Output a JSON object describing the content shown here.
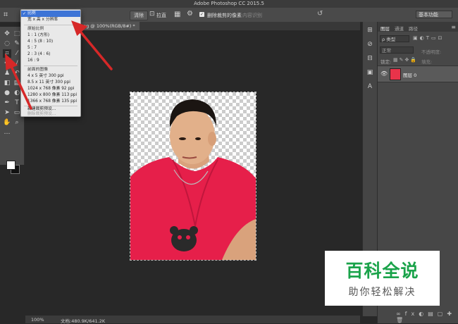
{
  "window": {
    "title": "Adobe Photoshop CC 2015.5",
    "colors": {
      "close": "#fc5f57",
      "minimize": "#fdbd2e",
      "zoom": "#28c840"
    }
  },
  "options_bar": {
    "crop_icon": "crop-icon",
    "clear_label": "清除",
    "straighten_label": "拉直",
    "delete_cropped_label": "删除裁剪的像素",
    "content_aware_label": "内容识别",
    "workspace_label": "基本功能"
  },
  "document": {
    "tab_label": "ng @ 100%(RGB/8#) *"
  },
  "dropdown": {
    "items": [
      {
        "label": "比例",
        "kind": "selected",
        "checked": true
      },
      {
        "label": "宽 x 高 x 分辨率",
        "kind": "normal"
      },
      {
        "label": "原始比例",
        "kind": "header"
      },
      {
        "label": "1 : 1 (方形)",
        "kind": "normal"
      },
      {
        "label": "4 : 5 (8 : 10)",
        "kind": "normal"
      },
      {
        "label": "5 : 7",
        "kind": "normal"
      },
      {
        "label": "2 : 3 (4 : 6)",
        "kind": "normal"
      },
      {
        "label": "16 : 9",
        "kind": "normal"
      },
      {
        "label": "前面的图像",
        "kind": "header"
      },
      {
        "label": "4 x 5 英寸 300 ppi",
        "kind": "normal"
      },
      {
        "label": "8.5 x 11 英寸 300 ppi",
        "kind": "normal"
      },
      {
        "label": "1024 x 768 像素 92 ppi",
        "kind": "normal"
      },
      {
        "label": "1280 x 800 像素 113 ppi",
        "kind": "normal"
      },
      {
        "label": "1366 x 768 像素 135 ppi",
        "kind": "normal"
      },
      {
        "label": "新建裁剪预设...",
        "kind": "normal"
      },
      {
        "label": "删除裁剪预设...",
        "kind": "disabled"
      }
    ]
  },
  "layers_panel": {
    "tabs": [
      "图层",
      "通道",
      "路径"
    ],
    "kind_label": "ρ 类型",
    "blend_mode": "正常",
    "opacity_label": "不透明度:",
    "lock_label": "锁定:",
    "fill_label": "填充:",
    "layer_name": "图层 0",
    "layer_thumb_color": "#e8334a"
  },
  "status_bar": {
    "zoom": "100%",
    "doc_size": "文档:480.9K/641.2K"
  },
  "watermark": {
    "title": "百科全说",
    "subtitle": "助你轻松解决",
    "color": "#1aa34a"
  },
  "annotation": {
    "arrow_color": "#d62828"
  }
}
